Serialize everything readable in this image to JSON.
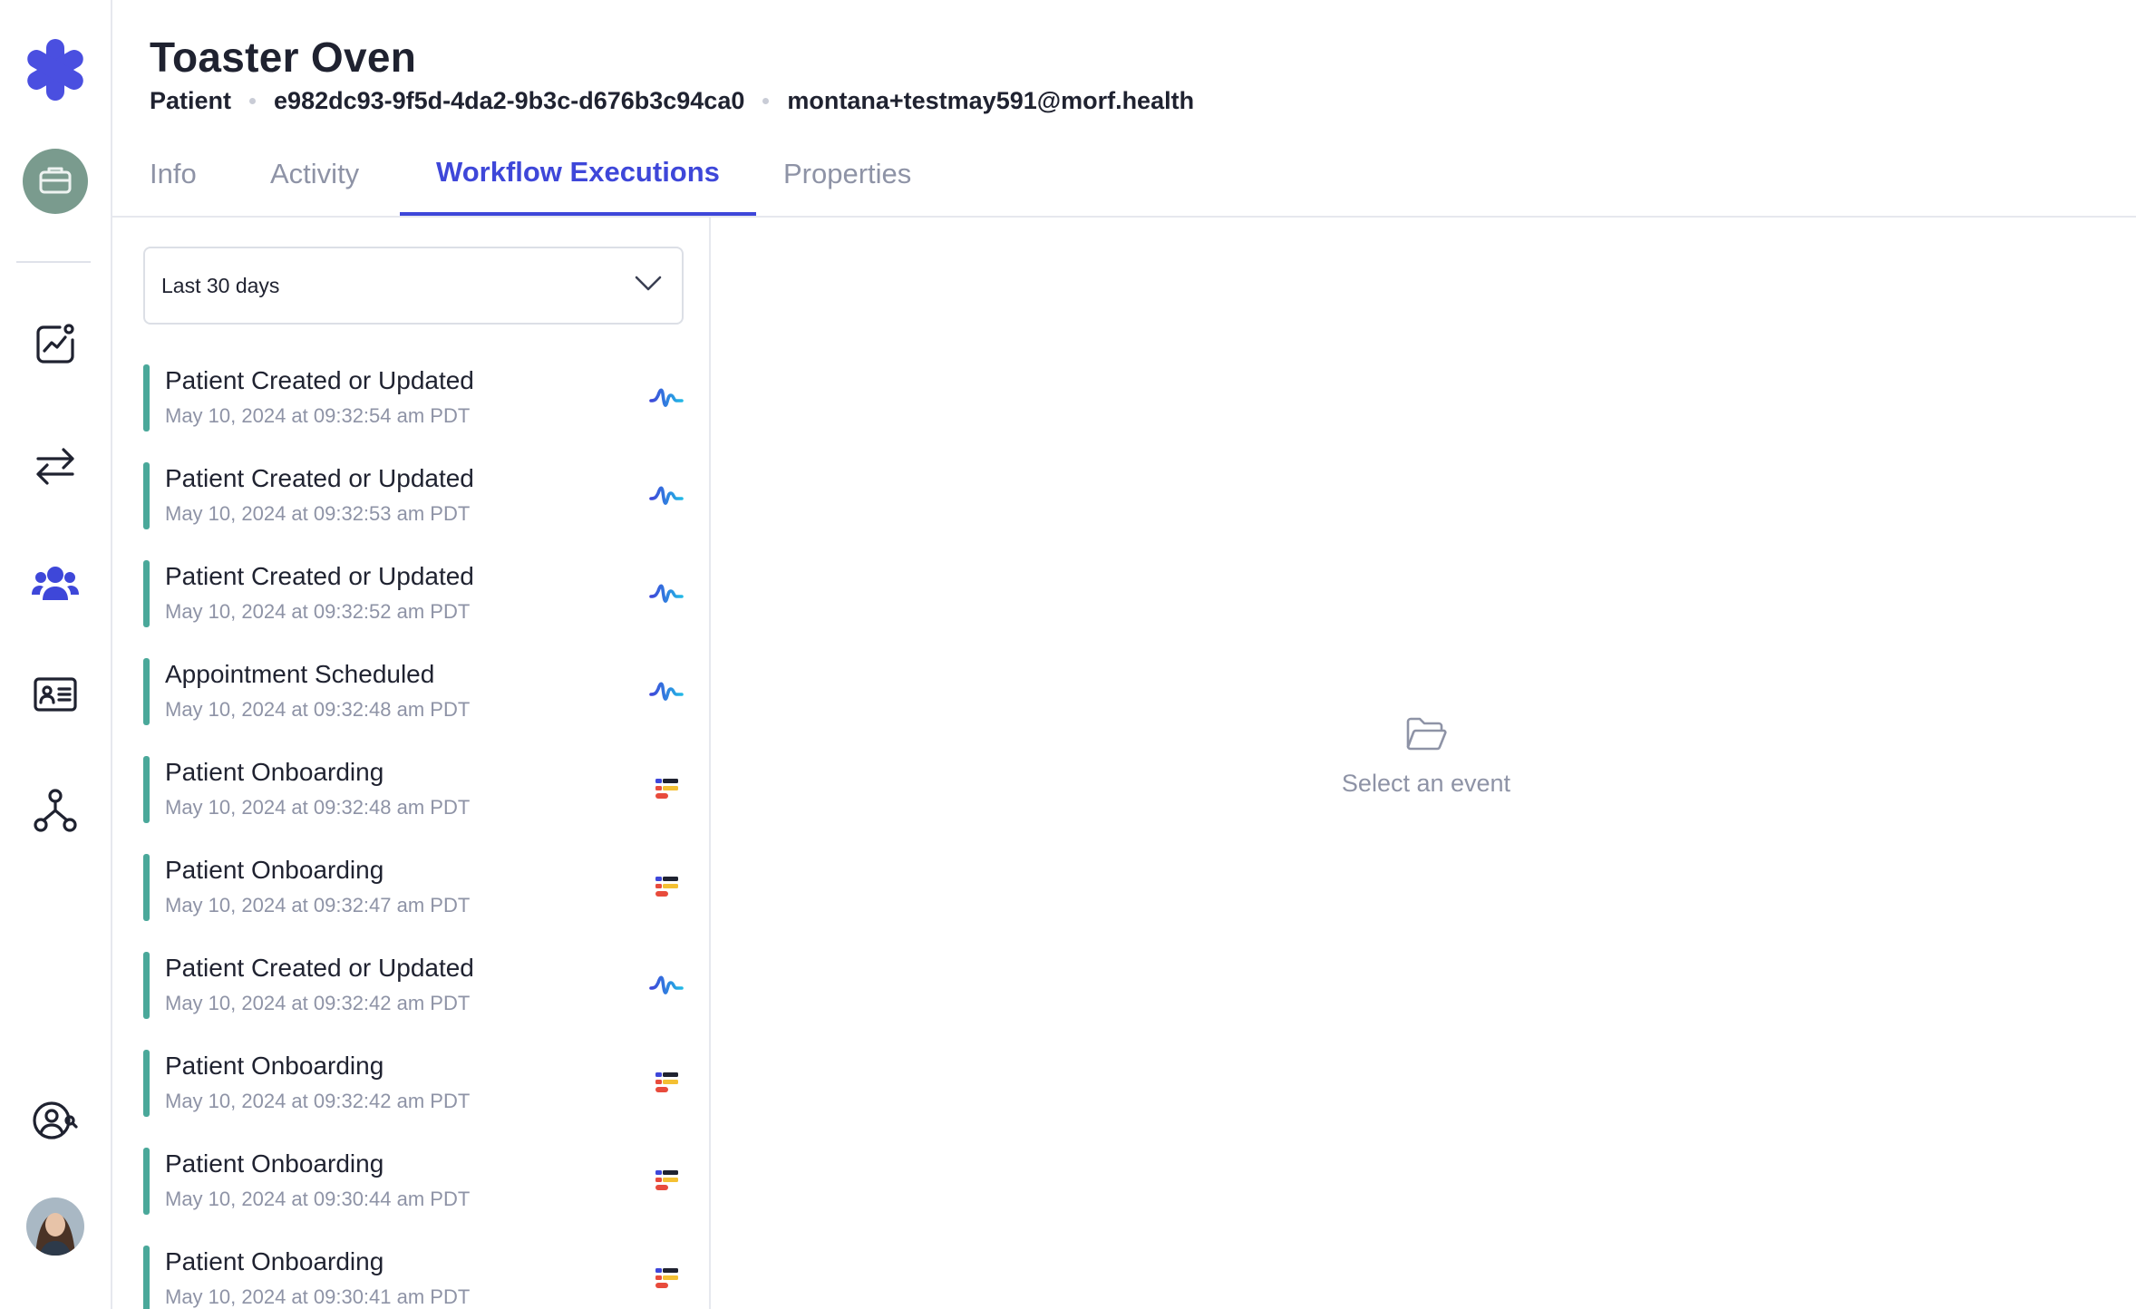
{
  "header": {
    "title": "Toaster Oven",
    "type": "Patient",
    "patient_id": "e982dc93-9f5d-4da2-9b3c-d676b3c94ca0",
    "email": "montana+testmay591@morf.health"
  },
  "tabs": [
    {
      "label": "Info",
      "active": false
    },
    {
      "label": "Activity",
      "active": false
    },
    {
      "label": "Workflow Executions",
      "active": true
    },
    {
      "label": "Properties",
      "active": false
    }
  ],
  "filter": {
    "selected": "Last 30 days"
  },
  "events": [
    {
      "name": "Patient Created or Updated",
      "time": "May 10, 2024 at 09:32:54 am PDT",
      "source": "wave-icon"
    },
    {
      "name": "Patient Created or Updated",
      "time": "May 10, 2024 at 09:32:53 am PDT",
      "source": "wave-icon"
    },
    {
      "name": "Patient Created or Updated",
      "time": "May 10, 2024 at 09:32:52 am PDT",
      "source": "wave-icon"
    },
    {
      "name": "Appointment Scheduled",
      "time": "May 10, 2024 at 09:32:48 am PDT",
      "source": "wave-icon"
    },
    {
      "name": "Patient Onboarding",
      "time": "May 10, 2024 at 09:32:48 am PDT",
      "source": "form-icon"
    },
    {
      "name": "Patient Onboarding",
      "time": "May 10, 2024 at 09:32:47 am PDT",
      "source": "form-icon"
    },
    {
      "name": "Patient Created or Updated",
      "time": "May 10, 2024 at 09:32:42 am PDT",
      "source": "wave-icon"
    },
    {
      "name": "Patient Onboarding",
      "time": "May 10, 2024 at 09:32:42 am PDT",
      "source": "form-icon"
    },
    {
      "name": "Patient Onboarding",
      "time": "May 10, 2024 at 09:30:44 am PDT",
      "source": "form-icon"
    },
    {
      "name": "Patient Onboarding",
      "time": "May 10, 2024 at 09:30:41 am PDT",
      "source": "form-icon"
    }
  ],
  "empty_state": {
    "label": "Select an event"
  },
  "colors": {
    "accent": "#3e47d9",
    "logo": "#4a4fe0",
    "status_bar": "#4aa89a",
    "muted_text": "#8e93a6"
  },
  "sidebar": {
    "items": [
      "logo-icon",
      "briefcase-icon",
      "analytics-icon",
      "transfer-icon",
      "users-icon",
      "id-card-icon",
      "workflow-icon",
      "user-search-icon",
      "avatar"
    ]
  }
}
